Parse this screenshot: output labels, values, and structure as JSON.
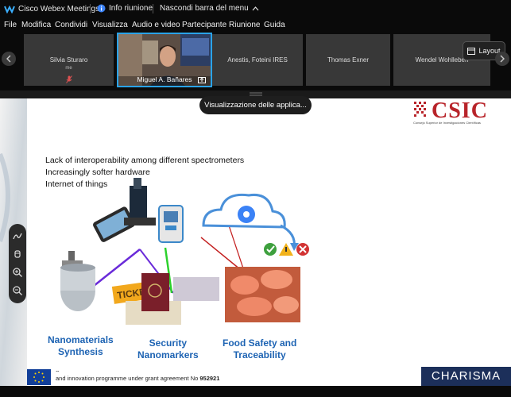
{
  "titlebar": {
    "app_title": "Cisco Webex Meetings",
    "info_label": "Info riunione",
    "hide_menu_label": "Nascondi barra del menu"
  },
  "menubar": {
    "items": [
      "File",
      "Modifica",
      "Condividi",
      "Visualizza",
      "Audio e video",
      "Partecipante",
      "Riunione",
      "Guida"
    ]
  },
  "participants": [
    {
      "name": "Silvia Sturaro",
      "sub": "me"
    },
    {
      "name": "Miguel A. Bañares",
      "sub": ""
    },
    {
      "name": "Anestis, Foteini IRES",
      "sub": ""
    },
    {
      "name": "Thomas Exner",
      "sub": ""
    },
    {
      "name": "Wendel Wohlleben",
      "sub": ""
    }
  ],
  "layout_button": "Layout",
  "share_toast": "Visualizzazione delle applica...",
  "slide": {
    "logo_text": "CSIC",
    "logo_sub": "Consejo Superior de Investigaciones Científicas",
    "bullets": [
      "Lack of interoperability among different spectrometers",
      "Increasingly softer hardware",
      "Internet of things"
    ],
    "labels": {
      "nano": [
        "Nanomaterials",
        "Synthesis"
      ],
      "security": [
        "Security",
        "Nanomarkers"
      ],
      "food": [
        "Food Safety and",
        "Traceability"
      ]
    },
    "ticket_text": "TICKET",
    "footer_line1": "g",
    "footer_line2": "and innovation programme under grant agreement No ",
    "footer_number": "952921",
    "charisma": "CHARISMA"
  },
  "icons": {
    "webex": "webex-logo-icon",
    "info": "info-icon",
    "chevron": "chevron-up-icon",
    "mic_muted": "mic-muted-icon",
    "layout": "layout-icon",
    "share": "share-icon",
    "tools": [
      "annotate-icon",
      "pointer-icon",
      "zoom-in-icon",
      "zoom-out-icon"
    ]
  }
}
